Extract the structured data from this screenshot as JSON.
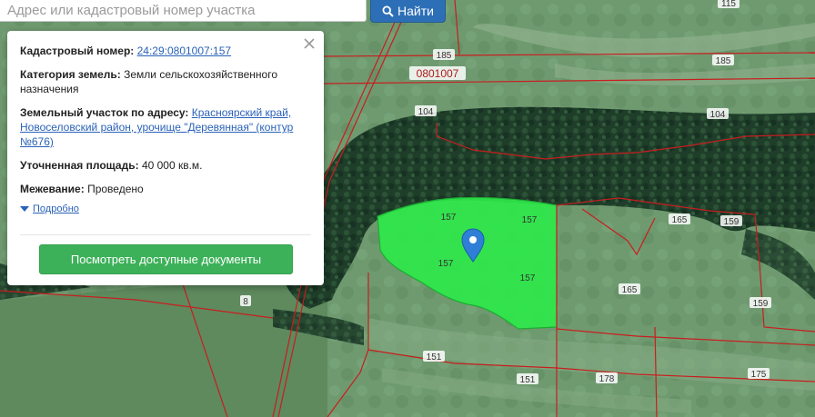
{
  "search": {
    "placeholder": "Адрес или кадастровый номер участка",
    "button_label": "Найти"
  },
  "popup": {
    "cadastral_label": "Кадастровый номер:",
    "cadastral_value": "24:29:0801007:157",
    "category_label": "Категория земель:",
    "category_value": "Земли сельскохозяйственного назначения",
    "address_label": "Земельный участок по адресу:",
    "address_value": "Красноярский край, Новоселовский район, урочище \"Деревянная\" (контур №676)",
    "area_label": "Уточненная площадь:",
    "area_value": "40 000 кв.м.",
    "survey_label": "Межевание:",
    "survey_value": "Проведено",
    "more_label": "Подробно",
    "docs_button": "Посмотреть доступные документы"
  },
  "map": {
    "quarter_label": "0801007",
    "parcel_labels": [
      "115",
      "185",
      "185",
      "104",
      "104",
      "157",
      "157",
      "157",
      "157",
      "165",
      "159",
      "165",
      "159",
      "8",
      "151",
      "151",
      "178",
      "175"
    ],
    "highlight_color": "#2ee84a",
    "boundary_color": "#c81e1e"
  }
}
